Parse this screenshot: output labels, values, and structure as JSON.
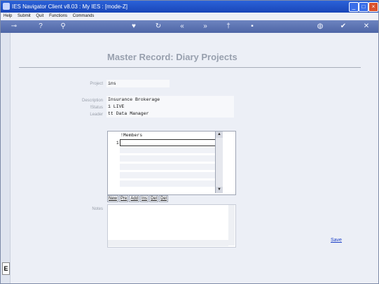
{
  "window": {
    "title": "IES Navigator Client v8.03 : My IES :      [mode-Z]"
  },
  "menu": [
    "Help",
    "Submit",
    "Quit",
    "Functions",
    "Commands"
  ],
  "toolbar": {
    "icons": [
      "key-icon",
      "help-icon",
      "search-icon",
      "heart-icon",
      "refresh-icon",
      "back-icon",
      "forward-icon",
      "pin-icon",
      "document-icon",
      "globe-icon",
      "check-icon",
      "close-icon"
    ]
  },
  "page": {
    "heading": "Master Record: Diary Projects"
  },
  "form": {
    "project_label": "Project",
    "project_value": "ins",
    "description_label": "Description",
    "description_value": "Insurance Brokerage",
    "status_label": "!Status",
    "status_value": "1 LIVE",
    "leader_label": "Leader",
    "leader_value": "tt Data Manager"
  },
  "grid": {
    "header": "!Members",
    "row_number": "1"
  },
  "grid_buttons": [
    "New",
    "Pre",
    "Add",
    "Ins",
    "Del",
    "Del"
  ],
  "notes": {
    "label": "Notes"
  },
  "actions": {
    "save": "Save"
  },
  "left_tag": "E"
}
